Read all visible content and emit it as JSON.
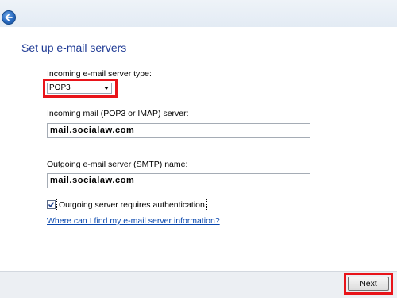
{
  "header": {
    "page_title": "Set up e-mail servers"
  },
  "form": {
    "server_type_label": "Incoming e-mail server type:",
    "server_type_value": "POP3",
    "incoming_label": "Incoming mail (POP3 or IMAP) server:",
    "incoming_value": "mail.socialaw.com",
    "outgoing_label": "Outgoing e-mail server (SMTP) name:",
    "outgoing_value": "mail.socialaw.com",
    "auth_label": "Outgoing server requires authentication",
    "auth_checked": true,
    "help_link": "Where can I find my e-mail server information?"
  },
  "footer": {
    "next_label": "Next"
  },
  "icons": {
    "back": "back-arrow-icon",
    "dropdown": "chevron-down-icon",
    "check": "checkmark-icon"
  },
  "colors": {
    "title": "#1f3b95",
    "link": "#0645ad",
    "highlight": "#e8141a",
    "back_button": "#2a6bc1"
  }
}
